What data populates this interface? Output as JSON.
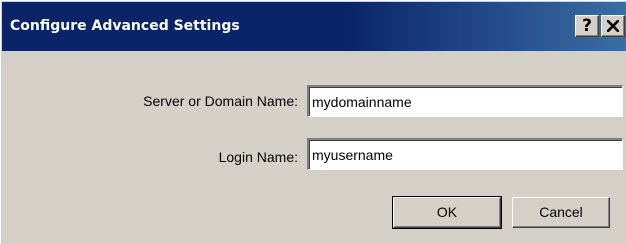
{
  "window": {
    "title": "Configure Advanced Settings",
    "help_button_label": "?",
    "close_icon": "close-icon"
  },
  "form": {
    "server_label": "Server or Domain Name:",
    "server_value": "mydomainname",
    "login_label": "Login Name:",
    "login_value": "myusername"
  },
  "buttons": {
    "ok_label": "OK",
    "cancel_label": "Cancel"
  },
  "colors": {
    "titlebar": "#0a246a",
    "dialog_face": "#d4d0c8",
    "title_text": "#ffffff"
  }
}
